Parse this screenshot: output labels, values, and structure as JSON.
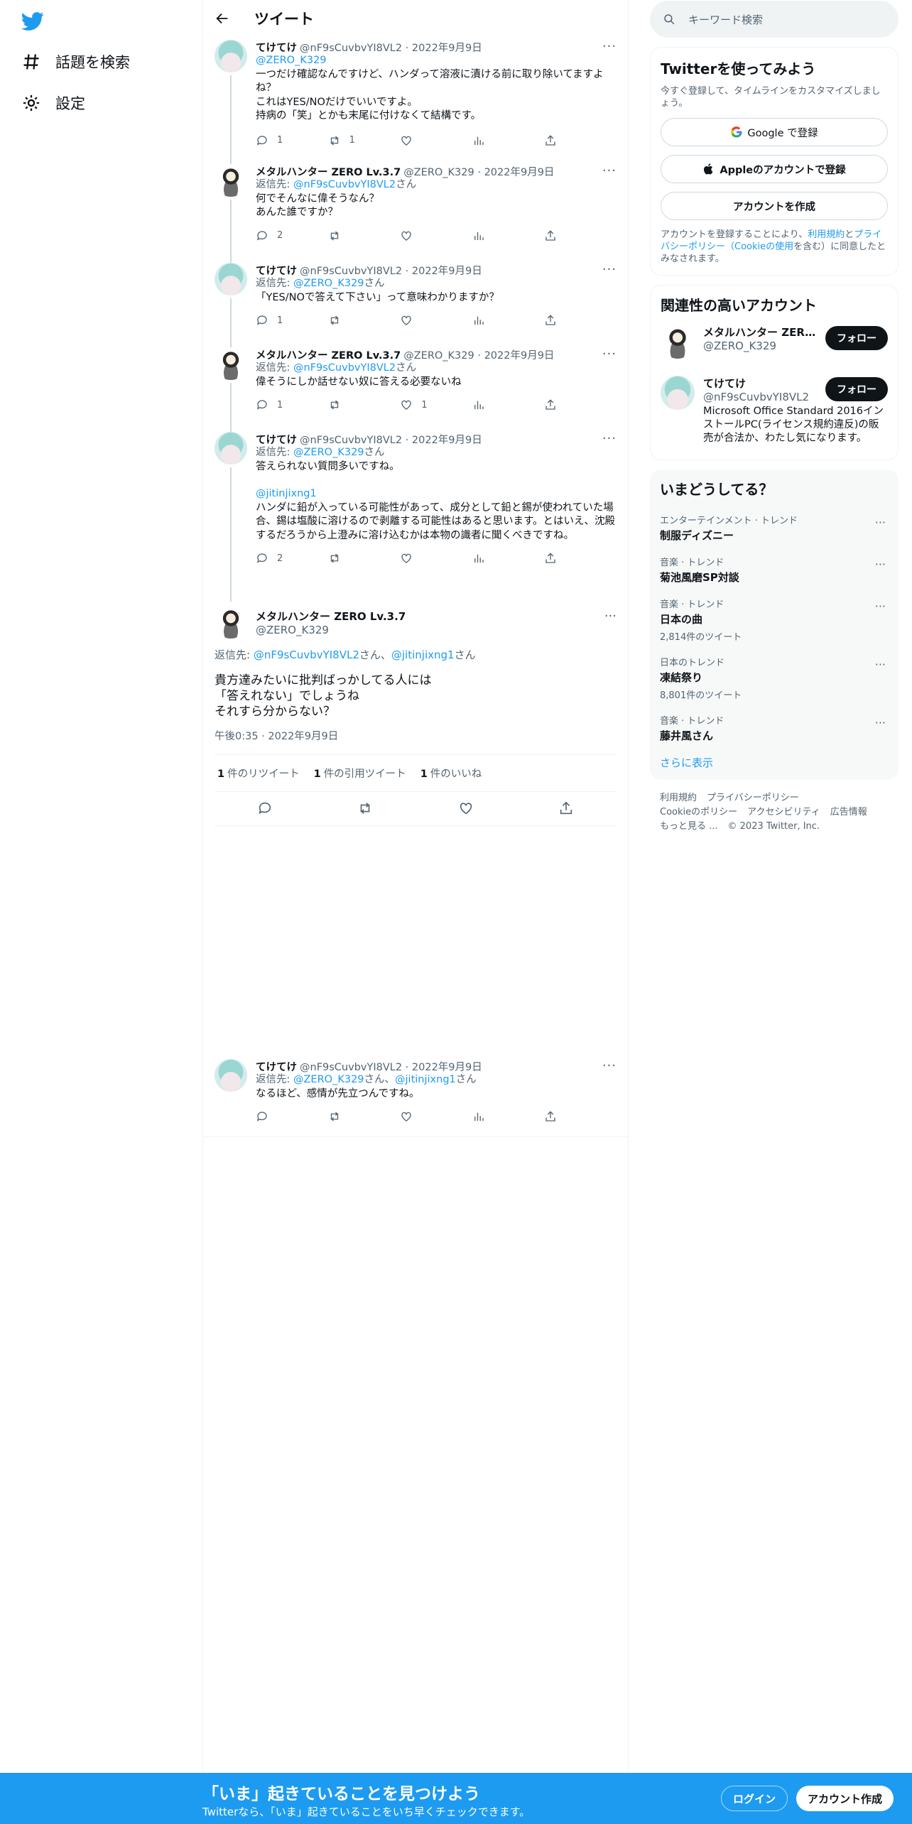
{
  "nav": {
    "explore": "話題を検索",
    "settings": "設定"
  },
  "header": {
    "title": "ツイート"
  },
  "tweets": [
    {
      "name": "てけてけ",
      "meta": "@nF9sCuvbvYI8VL2 · 2022年9月9日",
      "reply_to": "@ZERO_K329",
      "text": "一つだけ確認なんですけど、ハンダって溶液に漬ける前に取り除いてますよね？\nこれはYES/NOだけでいいですよ。\n持病の「笑」とかも末尾に付けなくて結構です。",
      "replies": "1",
      "retweets": "1",
      "likes": ""
    },
    {
      "name": "メタルハンター ZERO Lv.3.7",
      "meta": "@ZERO_K329 · 2022年9月9日",
      "reply_prefix": "返信先: ",
      "reply_to": "@nF9sCuvbvYI8VL2",
      "reply_suffix": "さん",
      "text": "何でそんなに偉そうなん？\nあんた誰ですか？",
      "replies": "2",
      "retweets": "",
      "likes": ""
    },
    {
      "name": "てけてけ",
      "meta": "@nF9sCuvbvYI8VL2 · 2022年9月9日",
      "reply_prefix": "返信先: ",
      "reply_to": "@ZERO_K329",
      "reply_suffix": "さん",
      "text": "「YES/NOで答えて下さい」って意味わかりますか？",
      "replies": "1",
      "retweets": "",
      "likes": ""
    },
    {
      "name": "メタルハンター ZERO Lv.3.7",
      "meta": "@ZERO_K329 · 2022年9月9日",
      "reply_prefix": "返信先: ",
      "reply_to": "@nF9sCuvbvYI8VL2",
      "reply_suffix": "さん",
      "text": "偉そうにしか話せない奴に答える必要ないね",
      "replies": "1",
      "retweets": "",
      "likes": "1"
    },
    {
      "name": "てけてけ",
      "meta": "@nF9sCuvbvYI8VL2 · 2022年9月9日",
      "reply_prefix": "返信先: ",
      "reply_to": "@ZERO_K329",
      "reply_suffix": "さん",
      "text": "答えられない質問多いですね。",
      "mention": "@jitinjixng1",
      "text2": "ハンダに鉛が入っている可能性があって、成分として鉛と錫が使われていた場合、錫は塩酸に溶けるので剥離する可能性はあると思います。とはいえ、沈殿するだろうから上澄みに溶け込むかは本物の識者に聞くべきですね。",
      "replies": "2",
      "retweets": "",
      "likes": ""
    }
  ],
  "focus": {
    "name": "メタルハンター ZERO Lv.3.7",
    "handle": "@ZERO_K329",
    "reply_prefix": "返信先: ",
    "reply_to1": "@nF9sCuvbvYI8VL2",
    "reply_mid": "さん、",
    "reply_to2": "@jitinjixng1",
    "reply_suffix": "さん",
    "text": "貴方達みたいに批判ばっかしてる人には\n「答えれない」でしょうね\nそれすら分からない？",
    "time": "午後0:35 · 2022年9月9日",
    "stats": [
      {
        "n": "1",
        "l": "件のリツイート"
      },
      {
        "n": "1",
        "l": "件の引用ツイート"
      },
      {
        "n": "1",
        "l": "件のいいね"
      }
    ]
  },
  "last_tweet": {
    "name": "てけてけ",
    "meta": "@nF9sCuvbvYI8VL2 · 2022年9月9日",
    "reply_prefix": "返信先: ",
    "reply_to1": "@ZERO_K329",
    "reply_mid": "さん、",
    "reply_to2": "@jitinjixng1",
    "reply_suffix": "さん",
    "text": "なるほど、感情が先立つんですね。"
  },
  "search": {
    "placeholder": "キーワード検索"
  },
  "signup": {
    "title": "Twitterを使ってみよう",
    "sub": "今すぐ登録して、タイムラインをカスタマイズしましょう。",
    "google": "Google で登録",
    "apple": "Appleのアカウントで登録",
    "create": "アカウントを作成",
    "terms1": "アカウントを登録することにより、",
    "terms_link1": "利用規約",
    "terms2": "と",
    "terms_link2": "プライバシーポリシー（Cookieの使用",
    "terms3": "を含む）に同意したとみなされます。"
  },
  "related": {
    "title": "関連性の高いアカウント",
    "follow": "フォロー",
    "accounts": [
      {
        "name": "メタルハンター ZER...",
        "handle": "@ZERO_K329",
        "bio": ""
      },
      {
        "name": "てけてけ",
        "handle": "@nF9sCuvbvYI8VL2",
        "bio": "Microsoft Office Standard 2016インストールPC(ライセンス規約違反)の販売が合法か、わたし気になります。"
      }
    ]
  },
  "trends": {
    "title": "いまどうしてる？",
    "show_more": "さらに表示",
    "items": [
      {
        "cat": "エンターテインメント · トレンド",
        "name": "制服ディズニー",
        "count": ""
      },
      {
        "cat": "音楽 · トレンド",
        "name": "菊池風磨SP対談",
        "count": ""
      },
      {
        "cat": "音楽 · トレンド",
        "name": "日本の曲",
        "count": "2,814件のツイート"
      },
      {
        "cat": "日本のトレンド",
        "name": "凍結祭り",
        "count": "8,801件のツイート"
      },
      {
        "cat": "音楽 · トレンド",
        "name": "藤井風さん",
        "count": ""
      }
    ]
  },
  "footer": {
    "terms": "利用規約",
    "privacy": "プライバシーポリシー",
    "cookie": "Cookieのポリシー",
    "access": "アクセシビリティ",
    "ads": "広告情報",
    "more": "もっと見る ...",
    "copy": "© 2023 Twitter, Inc."
  },
  "bottom": {
    "title": "「いま」起きていることを見つけよう",
    "sub": "Twitterなら、「いま」起きていることをいち早くチェックできます。",
    "login": "ログイン",
    "signup": "アカウント作成"
  },
  "colors": {
    "accent": "#1d9bf0",
    "text": "#0f1419",
    "muted": "#536471"
  }
}
